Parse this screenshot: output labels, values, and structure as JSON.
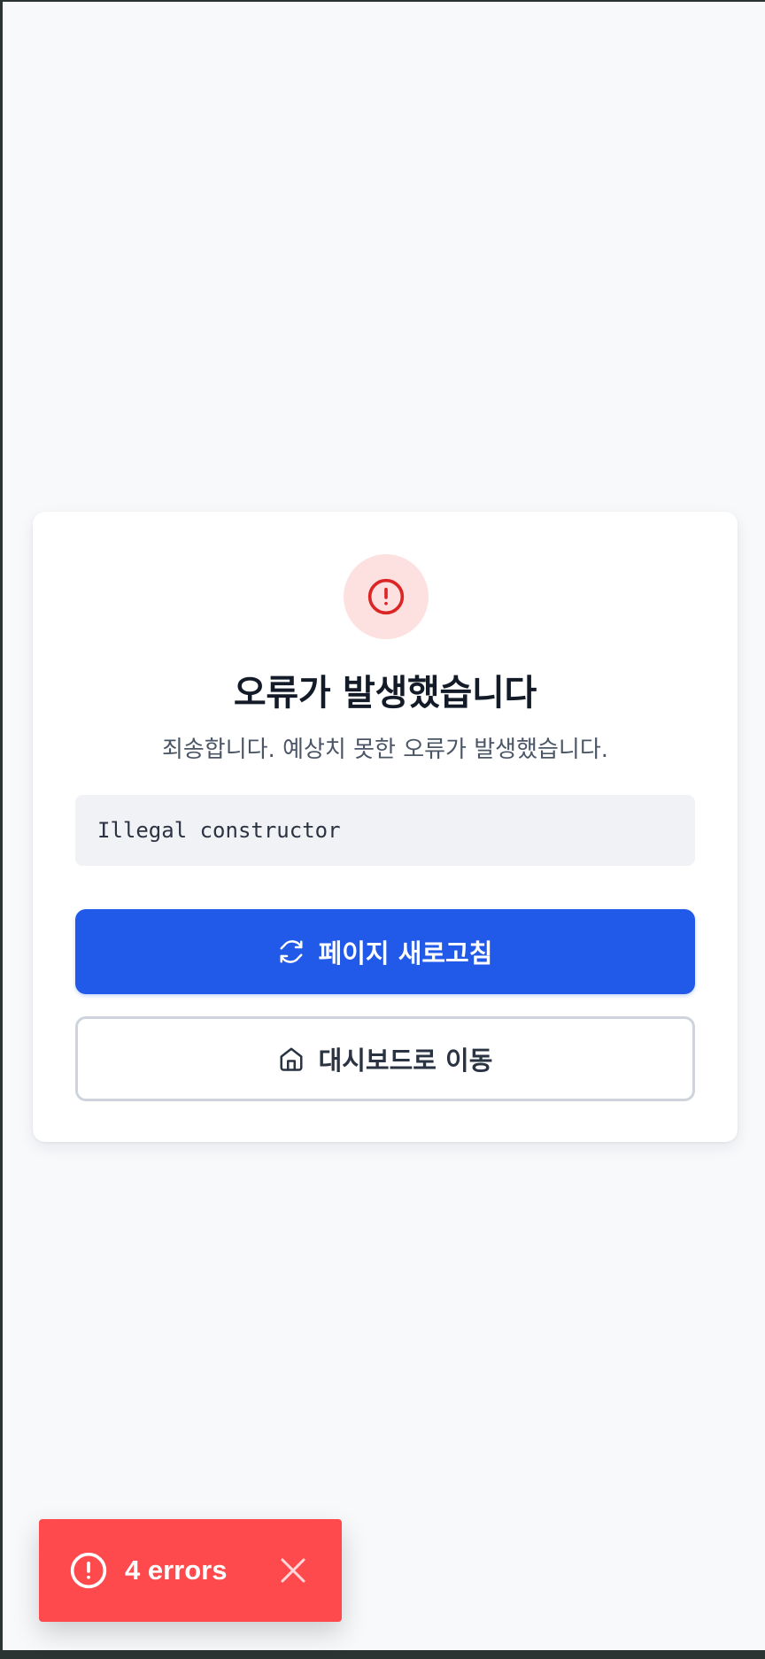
{
  "error_page": {
    "title": "오류가 발생했습니다",
    "subtitle": "죄송합니다. 예상치 못한 오류가 발생했습니다.",
    "error_message": "Illegal constructor",
    "refresh_button_label": "페이지 새로고침",
    "dashboard_button_label": "대시보드로 이동"
  },
  "toast": {
    "label": "4 errors"
  },
  "colors": {
    "primary": "#2159e8",
    "error": "#dc2626",
    "error_bg": "#fde1e1",
    "toast": "#ff4a4d"
  },
  "icons": {
    "error_icon": "alert-circle-icon",
    "refresh_icon": "refresh-icon",
    "home_icon": "home-icon",
    "toast_icon": "alert-circle-icon",
    "close_icon": "close-icon"
  }
}
